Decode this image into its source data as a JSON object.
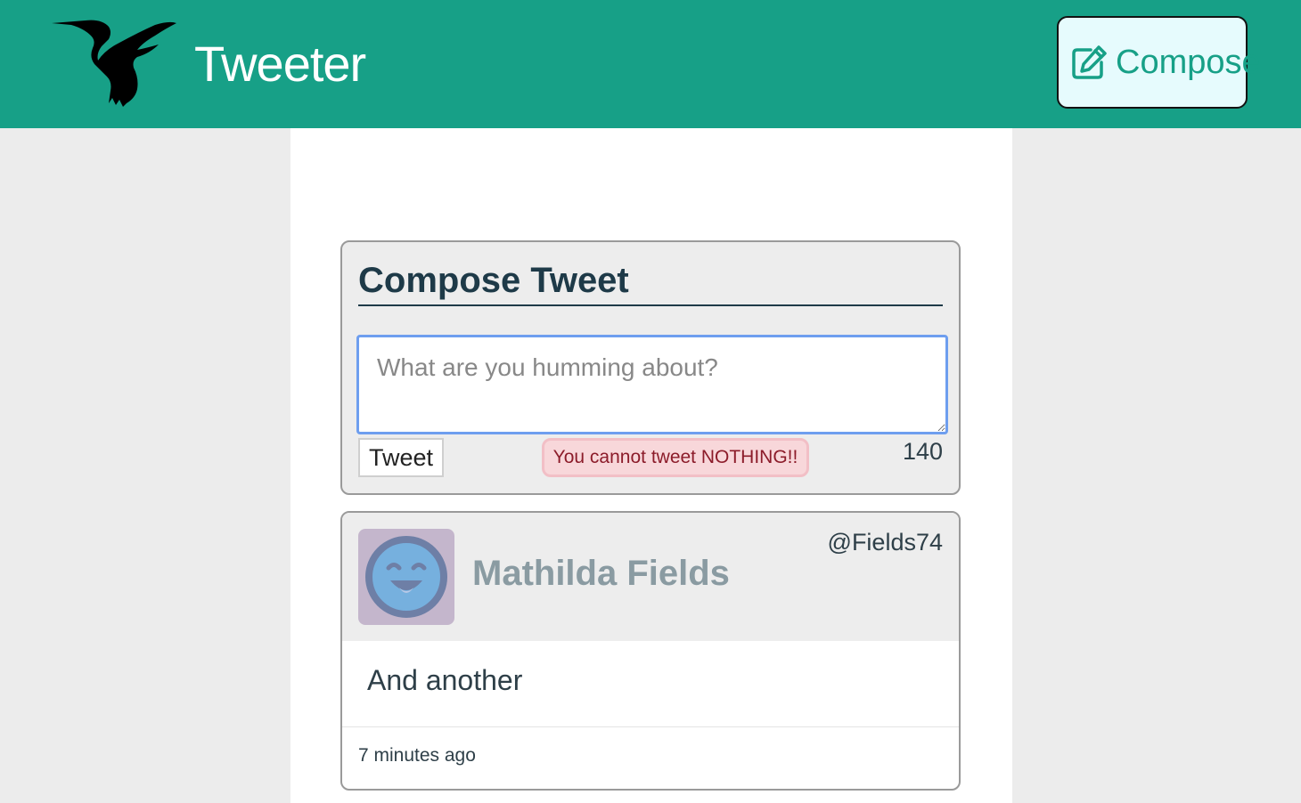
{
  "nav": {
    "brand": "Tweeter",
    "compose_label": "Compose",
    "logo_icon": "hummingbird-icon",
    "compose_icon": "edit-icon"
  },
  "compose": {
    "title": "Compose Tweet",
    "placeholder": "What are you humming about?",
    "value": "",
    "tweet_button": "Tweet",
    "error": "You cannot tweet NOTHING!!",
    "counter": "140"
  },
  "tweets": [
    {
      "name": "Mathilda Fields",
      "handle": "@Fields74",
      "text": "And another",
      "time": "7 minutes ago",
      "avatar_icon": "smiley-avatar-icon"
    }
  ],
  "colors": {
    "nav_bg": "#17a087",
    "accent": "#17a087",
    "error_bg": "#f8d7da",
    "error_text": "#8c1c2a",
    "heading": "#1e3a48"
  }
}
